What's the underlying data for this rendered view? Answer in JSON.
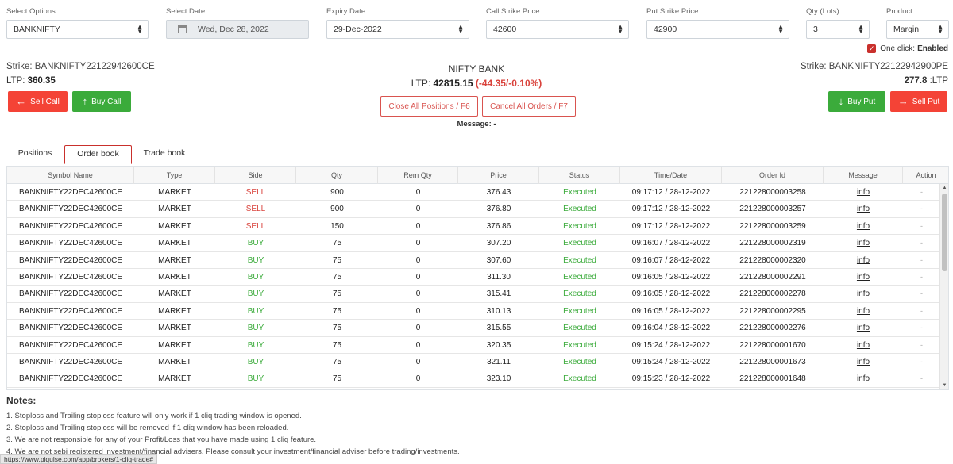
{
  "form": {
    "select_options": {
      "label": "Select Options",
      "value": "BANKNIFTY"
    },
    "select_date": {
      "label": "Select Date",
      "value": "Wed, Dec 28, 2022"
    },
    "expiry_date": {
      "label": "Expiry Date",
      "value": "29-Dec-2022"
    },
    "call_strike": {
      "label": "Call Strike Price",
      "value": "42600"
    },
    "put_strike": {
      "label": "Put Strike Price",
      "value": "42900"
    },
    "qty": {
      "label": "Qty (Lots)",
      "value": "3"
    },
    "product": {
      "label": "Product",
      "value": "Margin"
    }
  },
  "one_click": {
    "label": "One click:",
    "status": "Enabled",
    "checked": true
  },
  "left_instrument": {
    "strike_label": "Strike: BANKNIFTY22122942600CE",
    "ltp_prefix": "LTP:",
    "ltp_value": "360.35"
  },
  "right_instrument": {
    "strike_label": "Strike: BANKNIFTY22122942900PE",
    "ltp_value": "277.8",
    "ltp_suffix": ":LTP"
  },
  "index": {
    "name": "NIFTY BANK",
    "ltp_prefix": "LTP:",
    "ltp_value": "42815.15",
    "change": "(-44.35/-0.10%)"
  },
  "buttons": {
    "sell_call": "Sell Call",
    "buy_call": "Buy Call",
    "close_all": "Close All Positions / F6",
    "cancel_all": "Cancel All Orders / F7",
    "buy_put": "Buy Put",
    "sell_put": "Sell Put"
  },
  "message": "Message: -",
  "tabs": [
    "Positions",
    "Order book",
    "Trade book"
  ],
  "active_tab": "Order book",
  "table": {
    "headers": [
      "Symbol Name",
      "Type",
      "Side",
      "Qty",
      "Rem Qty",
      "Price",
      "Status",
      "Time/Date",
      "Order Id",
      "Message",
      "Action"
    ],
    "rows": [
      {
        "symbol": "BANKNIFTY22DEC42600CE",
        "type": "MARKET",
        "side": "SELL",
        "qty": "900",
        "rem": "0",
        "price": "376.43",
        "status": "Executed",
        "time": "09:17:12 / 28-12-2022",
        "order_id": "221228000003258",
        "message": "info",
        "action": "-"
      },
      {
        "symbol": "BANKNIFTY22DEC42600CE",
        "type": "MARKET",
        "side": "SELL",
        "qty": "900",
        "rem": "0",
        "price": "376.80",
        "status": "Executed",
        "time": "09:17:12 / 28-12-2022",
        "order_id": "221228000003257",
        "message": "info",
        "action": "-"
      },
      {
        "symbol": "BANKNIFTY22DEC42600CE",
        "type": "MARKET",
        "side": "SELL",
        "qty": "150",
        "rem": "0",
        "price": "376.86",
        "status": "Executed",
        "time": "09:17:12 / 28-12-2022",
        "order_id": "221228000003259",
        "message": "info",
        "action": "-"
      },
      {
        "symbol": "BANKNIFTY22DEC42600CE",
        "type": "MARKET",
        "side": "BUY",
        "qty": "75",
        "rem": "0",
        "price": "307.20",
        "status": "Executed",
        "time": "09:16:07 / 28-12-2022",
        "order_id": "221228000002319",
        "message": "info",
        "action": "-"
      },
      {
        "symbol": "BANKNIFTY22DEC42600CE",
        "type": "MARKET",
        "side": "BUY",
        "qty": "75",
        "rem": "0",
        "price": "307.60",
        "status": "Executed",
        "time": "09:16:07 / 28-12-2022",
        "order_id": "221228000002320",
        "message": "info",
        "action": "-"
      },
      {
        "symbol": "BANKNIFTY22DEC42600CE",
        "type": "MARKET",
        "side": "BUY",
        "qty": "75",
        "rem": "0",
        "price": "311.30",
        "status": "Executed",
        "time": "09:16:05 / 28-12-2022",
        "order_id": "221228000002291",
        "message": "info",
        "action": "-"
      },
      {
        "symbol": "BANKNIFTY22DEC42600CE",
        "type": "MARKET",
        "side": "BUY",
        "qty": "75",
        "rem": "0",
        "price": "315.41",
        "status": "Executed",
        "time": "09:16:05 / 28-12-2022",
        "order_id": "221228000002278",
        "message": "info",
        "action": "-"
      },
      {
        "symbol": "BANKNIFTY22DEC42600CE",
        "type": "MARKET",
        "side": "BUY",
        "qty": "75",
        "rem": "0",
        "price": "310.13",
        "status": "Executed",
        "time": "09:16:05 / 28-12-2022",
        "order_id": "221228000002295",
        "message": "info",
        "action": "-"
      },
      {
        "symbol": "BANKNIFTY22DEC42600CE",
        "type": "MARKET",
        "side": "BUY",
        "qty": "75",
        "rem": "0",
        "price": "315.55",
        "status": "Executed",
        "time": "09:16:04 / 28-12-2022",
        "order_id": "221228000002276",
        "message": "info",
        "action": "-"
      },
      {
        "symbol": "BANKNIFTY22DEC42600CE",
        "type": "MARKET",
        "side": "BUY",
        "qty": "75",
        "rem": "0",
        "price": "320.35",
        "status": "Executed",
        "time": "09:15:24 / 28-12-2022",
        "order_id": "221228000001670",
        "message": "info",
        "action": "-"
      },
      {
        "symbol": "BANKNIFTY22DEC42600CE",
        "type": "MARKET",
        "side": "BUY",
        "qty": "75",
        "rem": "0",
        "price": "321.11",
        "status": "Executed",
        "time": "09:15:24 / 28-12-2022",
        "order_id": "221228000001673",
        "message": "info",
        "action": "-"
      },
      {
        "symbol": "BANKNIFTY22DEC42600CE",
        "type": "MARKET",
        "side": "BUY",
        "qty": "75",
        "rem": "0",
        "price": "323.10",
        "status": "Executed",
        "time": "09:15:23 / 28-12-2022",
        "order_id": "221228000001648",
        "message": "info",
        "action": "-"
      }
    ]
  },
  "notes": {
    "title": "Notes:",
    "items": [
      "1. Stoploss and Trailing stoploss feature will only work if 1 cliq trading window is opened.",
      "2. Stoploss and Trailing stoploss will be removed if 1 cliq window has been reloaded.",
      "3. We are not responsible for any of your Profit/Loss that you have made using 1 cliq feature.",
      "4. We are not sebi registered investment/financial advisers. Please consult your investment/financial adviser before trading/investments."
    ]
  },
  "status_url": "https://www.piqulse.com/app/brokers/1-cliq-trade#",
  "colors": {
    "sell": "#d9423b",
    "buy": "#3bab3b",
    "accent": "#c9302c"
  },
  "icons": {
    "sell": "arrow-left-icon",
    "buy": "arrow-up-icon",
    "buy_put": "arrow-down-icon",
    "sell_put": "arrow-right-icon"
  }
}
